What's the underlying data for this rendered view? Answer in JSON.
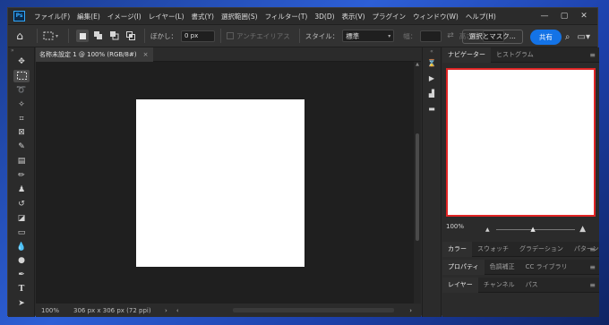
{
  "menu": {
    "logo": "Ps",
    "items": [
      "ファイル(F)",
      "編集(E)",
      "イメージ(I)",
      "レイヤー(L)",
      "書式(Y)",
      "選択範囲(S)",
      "フィルター(T)",
      "3D(D)",
      "表示(V)",
      "プラグイン",
      "ウィンドウ(W)",
      "ヘルプ(H)"
    ]
  },
  "window_controls": {
    "minimize": "—",
    "maximize": "▢",
    "close": "✕"
  },
  "options": {
    "feather_label": "ぼかし：",
    "feather_value": "0 px",
    "antialias_label": "アンチエイリアス",
    "style_label": "スタイル：",
    "style_value": "標準",
    "width_label": "幅：",
    "height_label": "高さ：",
    "select_mask_label": "選択とマスク...",
    "share_label": "共有"
  },
  "tools": [
    "move",
    "marquee",
    "lasso",
    "magic-wand",
    "crop",
    "frame",
    "eyedropper",
    "healing",
    "brush",
    "stamp",
    "history-brush",
    "eraser",
    "gradient",
    "blur",
    "dodge",
    "pen",
    "type",
    "path-select"
  ],
  "document": {
    "tab_title": "名称未設定 1 @ 100% (RGB/8#)",
    "close": "×",
    "zoom": "100%",
    "dimensions": "306 px x 306 px (72 ppi)"
  },
  "navigator": {
    "tabs": [
      "ナビゲーター",
      "ヒストグラム"
    ],
    "zoom": "100%",
    "zoom_slider_fraction": 0.47
  },
  "panel_groups": [
    {
      "tabs": [
        "カラー",
        "スウォッチ",
        "グラデーション",
        "パターン"
      ]
    },
    {
      "tabs": [
        "プロパティ",
        "色調補正",
        "CC ライブラリ"
      ]
    },
    {
      "tabs": [
        "レイヤー",
        "チャンネル",
        "パス"
      ]
    }
  ],
  "colors": {
    "accent": "#1473e6",
    "nav_frame": "#e02525"
  }
}
